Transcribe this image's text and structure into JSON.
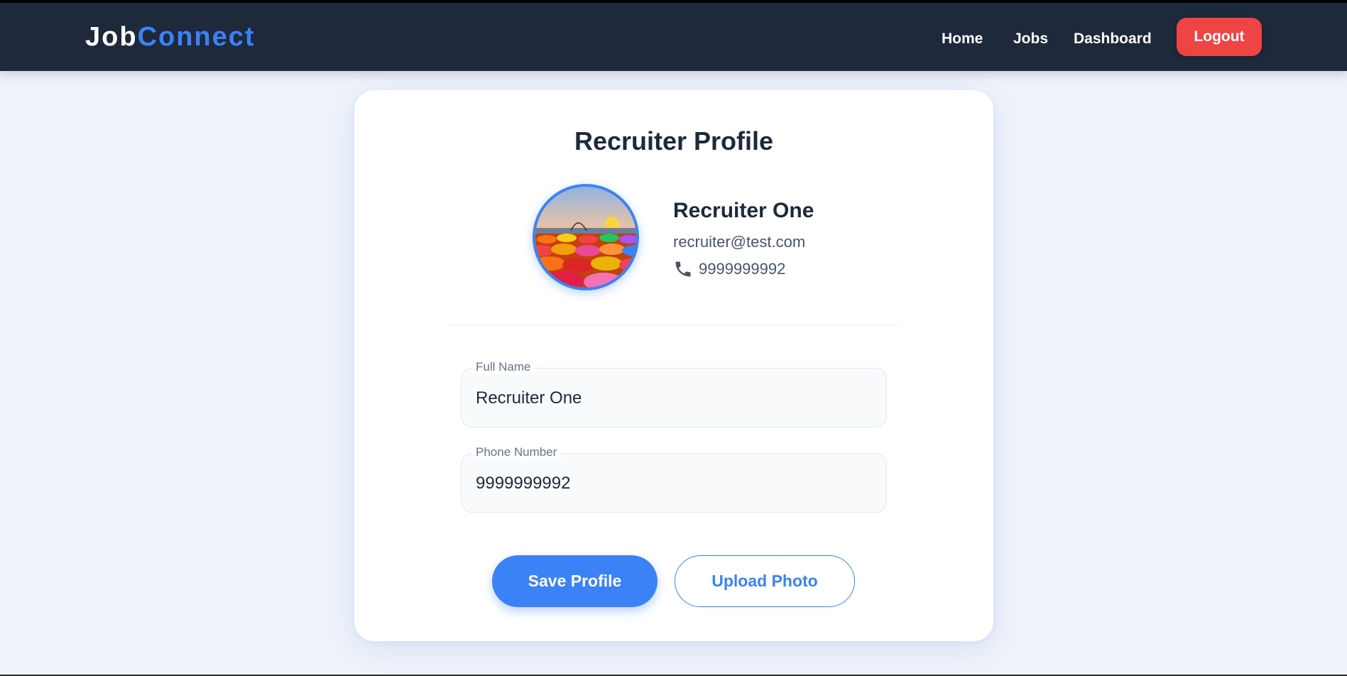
{
  "brand": {
    "part1": "Job",
    "part2": "Connect"
  },
  "nav": {
    "home": "Home",
    "jobs": "Jobs",
    "dashboard": "Dashboard",
    "logout": "Logout"
  },
  "profile": {
    "title": "Recruiter Profile",
    "name": "Recruiter One",
    "email": "recruiter@test.com",
    "phone": "9999999992",
    "avatar_icon": "beach-sunset-photo",
    "phone_icon": "phone-icon"
  },
  "form": {
    "full_name_label": "Full Name",
    "full_name_value": "Recruiter One",
    "phone_label": "Phone Number",
    "phone_value": "9999999992"
  },
  "actions": {
    "save": "Save Profile",
    "upload": "Upload Photo"
  },
  "colors": {
    "navbar": "#1e293b",
    "accent": "#3b82f6",
    "logout": "#ef4444",
    "page_bg": "#eef2f9"
  }
}
